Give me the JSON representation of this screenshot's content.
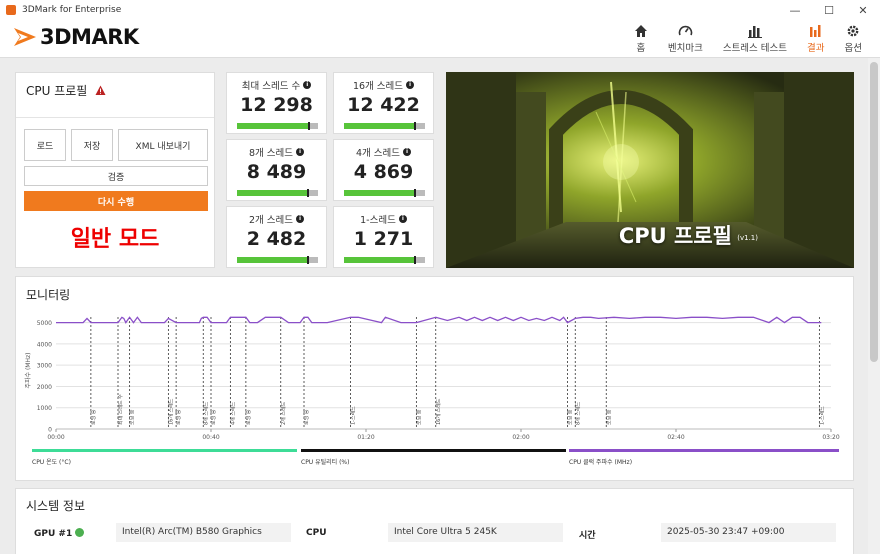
{
  "window": {
    "title": "3DMark for Enterprise"
  },
  "brand": {
    "name": "3DMARK",
    "accent": "#f07a1e"
  },
  "nav": [
    {
      "label": "홈",
      "icon": "home-icon"
    },
    {
      "label": "벤치마크",
      "icon": "gauge-icon"
    },
    {
      "label": "스트레스 테스트",
      "icon": "bar-chart-icon"
    },
    {
      "label": "결과",
      "icon": "results-icon",
      "active": true
    },
    {
      "label": "옵션",
      "icon": "gear-icon"
    }
  ],
  "profile": {
    "title": "CPU 프로필",
    "load": "로드",
    "save": "저장",
    "export_xml": "XML 내보내기",
    "validate": "검증",
    "rerun": "다시 수행",
    "mode": "일반 모드"
  },
  "scores": [
    {
      "label": "최대 스레드 수",
      "value": "12 298",
      "fill": 0.88
    },
    {
      "label": "16개 스레드",
      "value": "12 422",
      "fill": 0.86
    },
    {
      "label": "8개 스레드",
      "value": "8 489",
      "fill": 0.87
    },
    {
      "label": "4개 스레드",
      "value": "4 869",
      "fill": 0.87
    },
    {
      "label": "2개 스레드",
      "value": "2 482",
      "fill": 0.87
    },
    {
      "label": "1-스레드",
      "value": "1 271",
      "fill": 0.87
    }
  ],
  "hero": {
    "title": "CPU 프로필",
    "version": "(v1.1)"
  },
  "monitoring": {
    "title": "모니터링",
    "y_axis_label": "주파수 (MHz)",
    "legend": [
      {
        "label": "CPU 온도 (°C)",
        "color": "#3ddc97"
      },
      {
        "label": "CPU 유틸리티 (%)",
        "color": "#111111"
      },
      {
        "label": "CPU 클럭 주파수 (MHz)",
        "color": "#8a4fc8"
      }
    ]
  },
  "chart_data": {
    "type": "line",
    "title": "",
    "xlabel": "",
    "ylabel": "주파수 (MHz)",
    "x_ticks": [
      "00:00",
      "00:40",
      "01:20",
      "02:00",
      "02:40",
      "03:20"
    ],
    "y_ticks": [
      0,
      1000,
      2000,
      3000,
      4000,
      5000
    ],
    "xlim": [
      0,
      200
    ],
    "ylim": [
      0,
      5500
    ],
    "grid": true,
    "series": [
      {
        "name": "CPU 클럭 주파수 (MHz)",
        "color": "#8a4fc8",
        "x": [
          0,
          7,
          8,
          9,
          10,
          16,
          17,
          17.5,
          18,
          19,
          20,
          21,
          22,
          23,
          24,
          28,
          29,
          31,
          37,
          37.5,
          38,
          39,
          40,
          44,
          45,
          47,
          49,
          50,
          52,
          54,
          56,
          58,
          60,
          63,
          64,
          65,
          66,
          70,
          76,
          78,
          84,
          85,
          89,
          93,
          98,
          101,
          104,
          106,
          108,
          110,
          112,
          114,
          116,
          118,
          120,
          122,
          124,
          126,
          128,
          130,
          131,
          132,
          134,
          136,
          138,
          140,
          144,
          148,
          152,
          156,
          160,
          164,
          168,
          172,
          176,
          180,
          184,
          186,
          188,
          190,
          192,
          194,
          196,
          197.5
        ],
        "y": [
          5000,
          5000,
          5200,
          5000,
          5000,
          5000,
          5250,
          5200,
          5000,
          5250,
          5000,
          5250,
          5000,
          5000,
          5000,
          5000,
          5200,
          5000,
          5000,
          5200,
          5250,
          5250,
          5000,
          5000,
          5250,
          5250,
          5250,
          5000,
          5000,
          5250,
          5250,
          5250,
          5000,
          5000,
          5250,
          5250,
          5000,
          5000,
          5250,
          5250,
          5000,
          5250,
          5000,
          5000,
          5250,
          5100,
          5250,
          5100,
          5250,
          5100,
          5250,
          5100,
          5250,
          5100,
          5250,
          5100,
          5200,
          5100,
          5250,
          5100,
          5250,
          5000,
          5200,
          5250,
          5250,
          5200,
          5250,
          5200,
          5250,
          5250,
          5200,
          5250,
          5250,
          5200,
          5250,
          5250,
          5000,
          5250,
          5000,
          5250,
          5250,
          5000,
          5000,
          5000
        ]
      }
    ],
    "markers": [
      {
        "x": 9,
        "label": "로딩 중"
      },
      {
        "x": 16,
        "label": "최대 스레드 수"
      },
      {
        "x": 19,
        "label": "로딩 중"
      },
      {
        "x": 29,
        "label": "16개 스레드"
      },
      {
        "x": 31,
        "label": "로딩 중"
      },
      {
        "x": 38,
        "label": "8개 스레드"
      },
      {
        "x": 40,
        "label": "로딩 중"
      },
      {
        "x": 45,
        "label": "4개 스레드"
      },
      {
        "x": 49,
        "label": "로딩 중"
      },
      {
        "x": 58,
        "label": "2개 스레드"
      },
      {
        "x": 64,
        "label": "로딩 중"
      },
      {
        "x": 76,
        "label": "1-스레드"
      },
      {
        "x": 93,
        "label": "로딩 중"
      },
      {
        "x": 98,
        "label": "16개 스레드"
      },
      {
        "x": 132,
        "label": "로딩 중"
      },
      {
        "x": 134,
        "label": "8개 스레드"
      },
      {
        "x": 142,
        "label": "로딩 중"
      },
      {
        "x": 197,
        "label": "1-스레드"
      }
    ]
  },
  "system_info": {
    "title": "시스템 정보",
    "rows": [
      {
        "key": "GPU #1",
        "value": "Intel(R) Arc(TM) B580 Graphics",
        "ok": true
      },
      {
        "key": "CPU",
        "value": "Intel Core Ultra 5 245K"
      },
      {
        "key": "시간",
        "value": "2025-05-30 23:47 +09:00"
      }
    ]
  }
}
